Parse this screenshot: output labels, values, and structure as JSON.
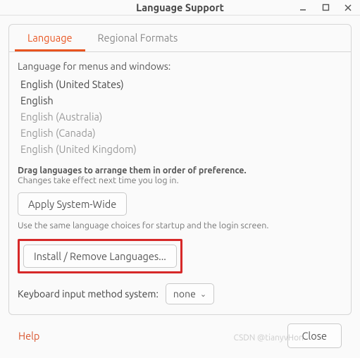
{
  "window": {
    "title": "Language Support"
  },
  "tabs": {
    "language": "Language",
    "regional": "Regional Formats"
  },
  "section": {
    "label": "Language for menus and windows:"
  },
  "languages": [
    {
      "name": "English (United States)",
      "dim": false
    },
    {
      "name": "English",
      "dim": false
    },
    {
      "name": "English (Australia)",
      "dim": true
    },
    {
      "name": "English (Canada)",
      "dim": true
    },
    {
      "name": "English (United Kingdom)",
      "dim": true
    }
  ],
  "hints": {
    "drag_bold": "Drag languages to arrange them in order of preference.",
    "drag_sub": "Changes take effect next time you log in.",
    "apply_btn": "Apply System-Wide",
    "apply_note": "Use the same language choices for startup and the login screen.",
    "install_btn": "Install / Remove Languages..."
  },
  "keyboard": {
    "label": "Keyboard input method system:",
    "value": "none"
  },
  "footer": {
    "help": "Help",
    "close": "Close"
  },
  "watermark": "CSDN @tianyvHon"
}
